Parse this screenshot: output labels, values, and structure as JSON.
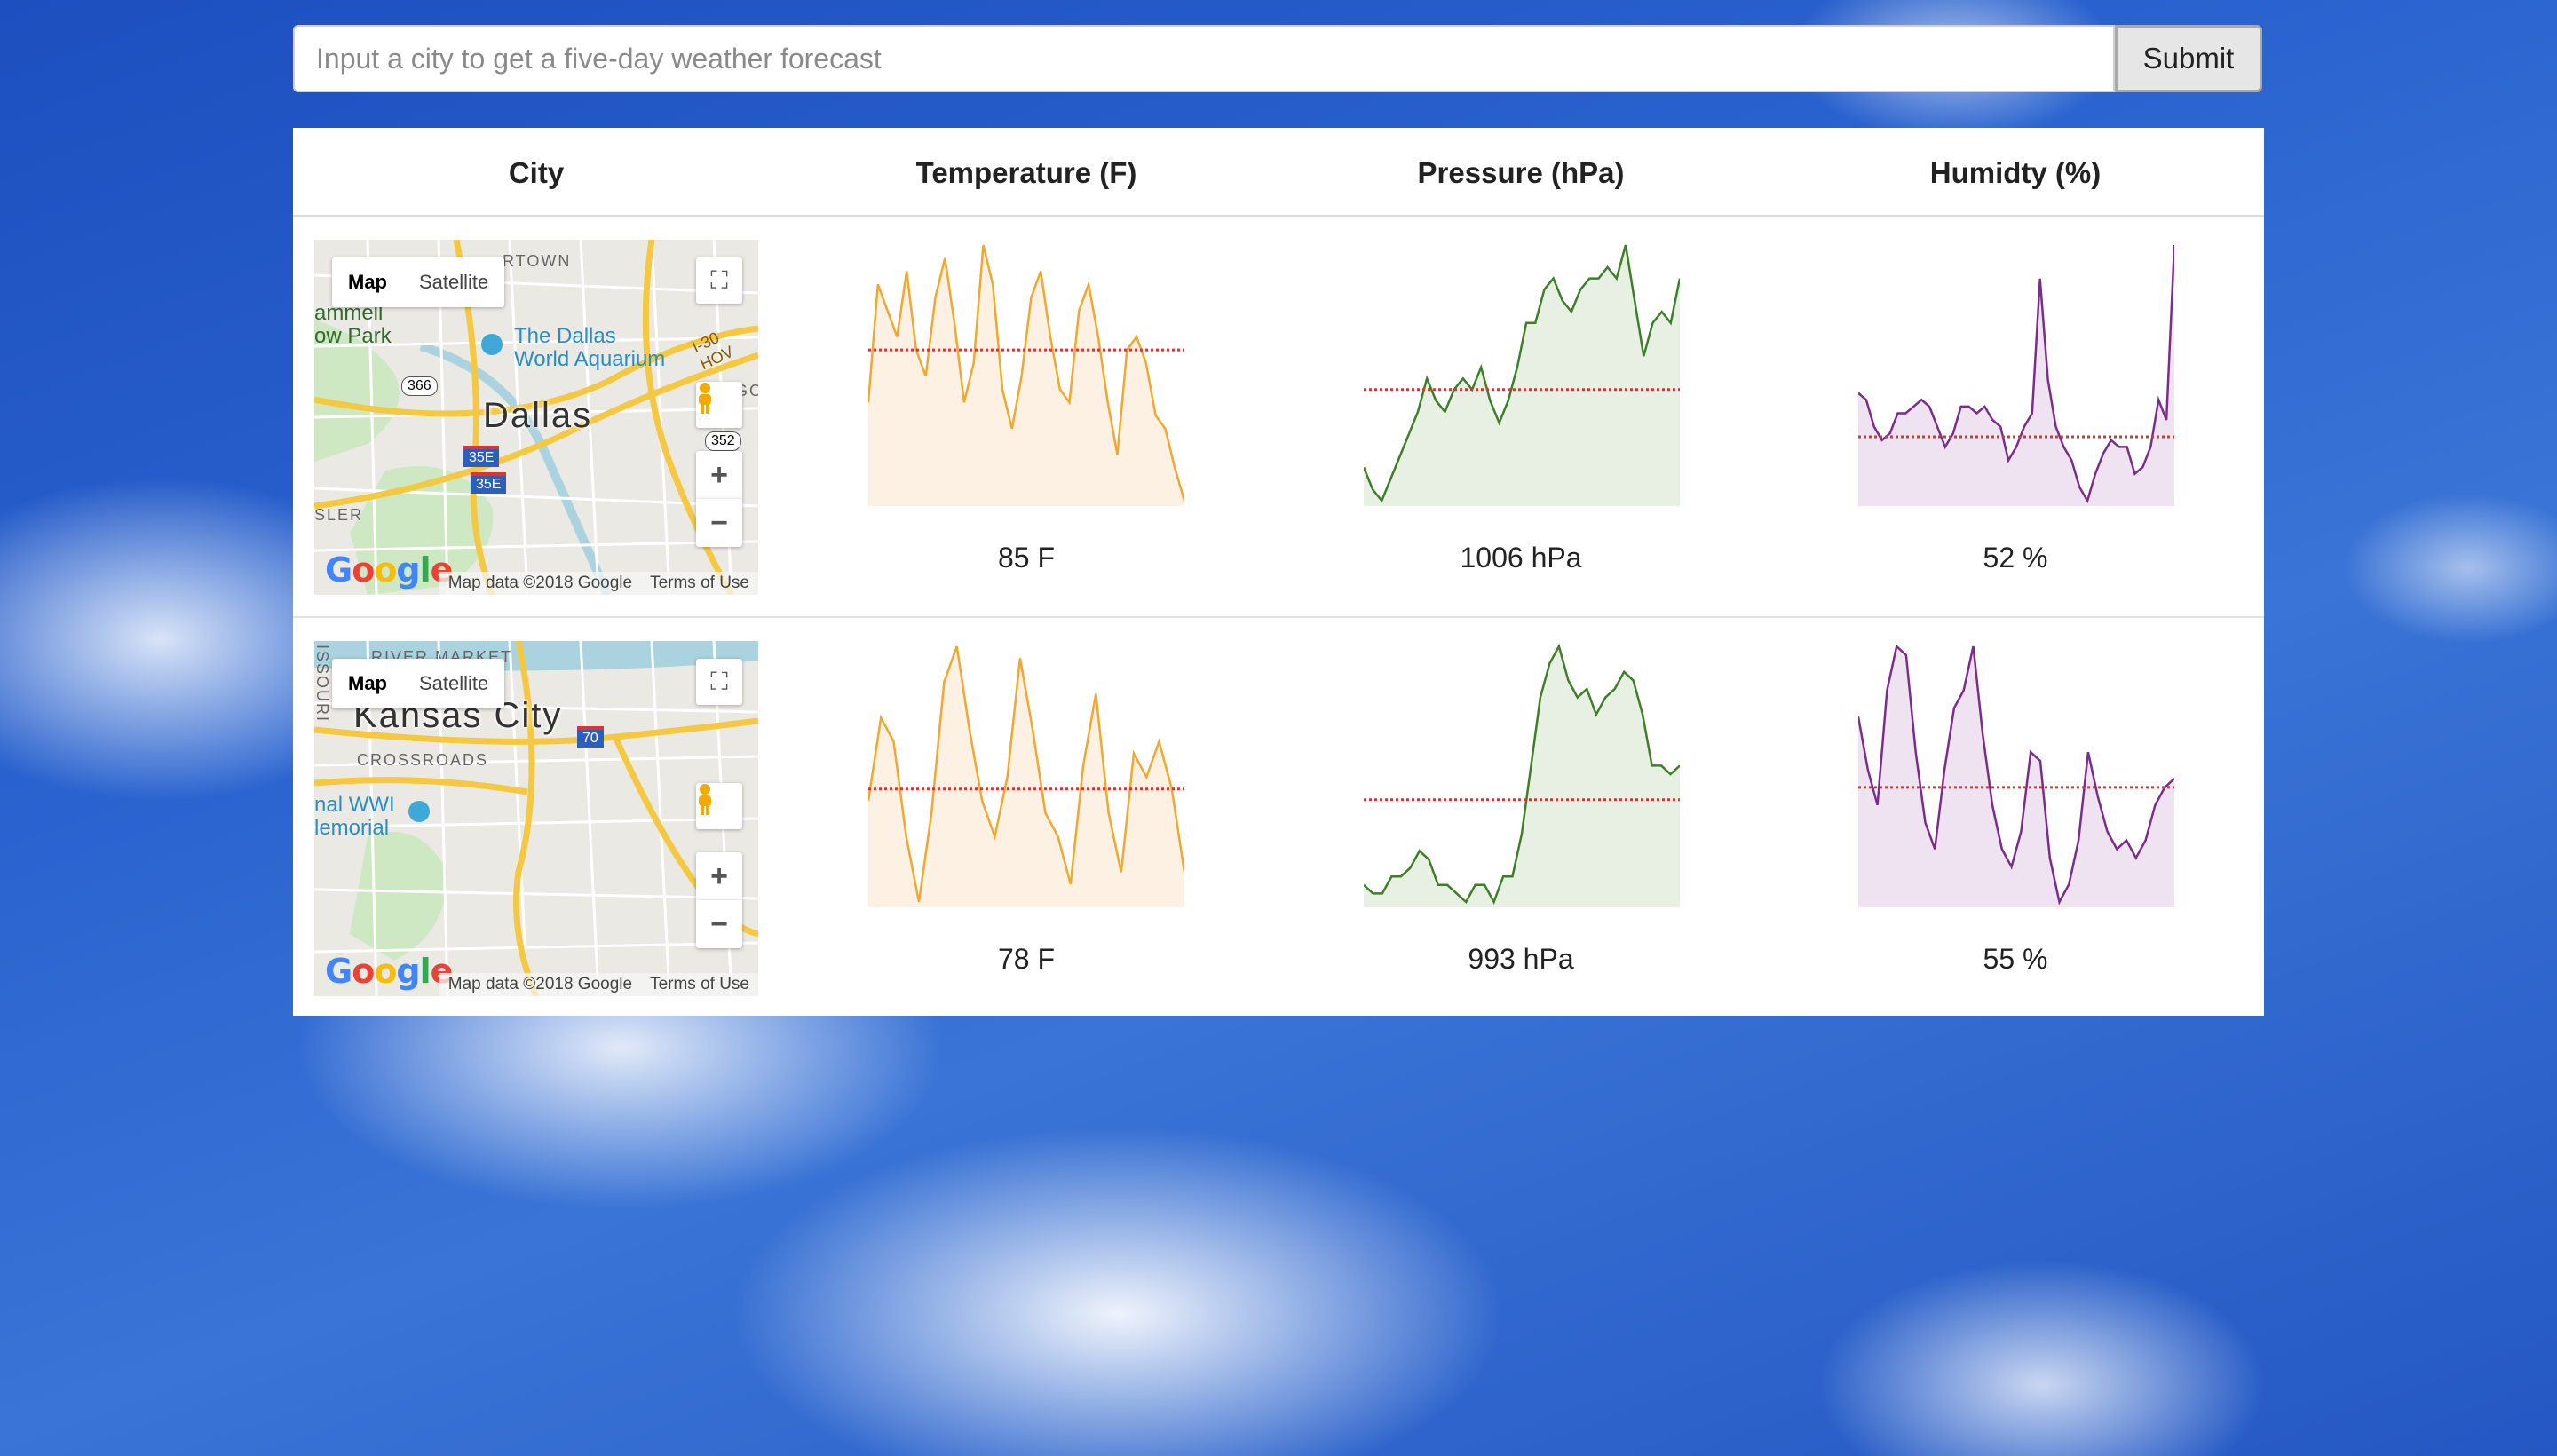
{
  "search": {
    "placeholder": "Input a city to get a five-day weather forecast",
    "value": "",
    "submit_label": "Submit"
  },
  "table": {
    "headers": [
      "City",
      "Temperature (F)",
      "Pressure (hPa)",
      "Humidty (%)"
    ]
  },
  "map_controls": {
    "map_label": "Map",
    "satellite_label": "Satellite",
    "attribution": "Map data ©2018 Google",
    "terms": "Terms of Use",
    "zoom_in": "+",
    "zoom_out": "−",
    "fullscreen": "⛶"
  },
  "rows": [
    {
      "city": "Dallas",
      "map_labels": {
        "city": "Dallas",
        "poi_1": "The Dallas",
        "poi_2": "World Aquarium",
        "park_1": "ammell",
        "park_2": "ow Park",
        "district": "RTOWN",
        "highway": "I-30 HOV",
        "shield_1": "366",
        "shield_2": "35E",
        "shield_3": "35E",
        "shield_4": "352",
        "edge_1": "SLER",
        "edge_2": "GO"
      },
      "temperature": {
        "summary": "85 F",
        "series": [
          70,
          88,
          84,
          80,
          90,
          78,
          74,
          86,
          92,
          82,
          70,
          76,
          94,
          88,
          72,
          66,
          74,
          86,
          90,
          80,
          72,
          70,
          84,
          88,
          80,
          70,
          62,
          78,
          80,
          76,
          68,
          66,
          60,
          55
        ]
      },
      "pressure": {
        "summary": "1006 hPa",
        "series": [
          999,
          997,
          996,
          998,
          1000,
          1002,
          1004,
          1007,
          1005,
          1004,
          1006,
          1007,
          1006,
          1008,
          1005,
          1003,
          1005,
          1008,
          1012,
          1012,
          1015,
          1016,
          1014,
          1013,
          1015,
          1016,
          1016,
          1017,
          1016,
          1019,
          1014,
          1009,
          1012,
          1013,
          1012,
          1016
        ]
      },
      "humidity": {
        "summary": "52 %",
        "series": [
          46,
          44,
          36,
          32,
          34,
          40,
          40,
          42,
          44,
          42,
          36,
          30,
          34,
          42,
          42,
          40,
          42,
          38,
          36,
          26,
          30,
          36,
          40,
          80,
          50,
          36,
          30,
          26,
          18,
          14,
          22,
          28,
          32,
          30,
          30,
          22,
          24,
          30,
          44,
          38,
          90
        ]
      },
      "averages": {
        "temperature": 78,
        "pressure": 1006,
        "humidity": 33
      }
    },
    {
      "city": "Kansas City",
      "map_labels": {
        "city": "Kansas City",
        "poi_1": "nal WWI",
        "poi_2": "lemorial",
        "district": "RIVER MARKET",
        "district_2": "CROSSROADS",
        "shield_1": "70",
        "edge_1": "ISSOURI"
      },
      "temperature": {
        "summary": "78 F",
        "series": [
          72,
          86,
          82,
          66,
          55,
          70,
          92,
          98,
          84,
          72,
          66,
          76,
          96,
          84,
          70,
          66,
          58,
          78,
          90,
          70,
          60,
          80,
          76,
          82,
          74,
          60
        ]
      },
      "pressure": {
        "summary": "993 hPa",
        "series": [
          990,
          989,
          989,
          991,
          991,
          992,
          994,
          993,
          990,
          990,
          989,
          988,
          990,
          990,
          988,
          991,
          991,
          996,
          1004,
          1012,
          1016,
          1018,
          1014,
          1012,
          1013,
          1010,
          1012,
          1013,
          1015,
          1014,
          1010,
          1004,
          1004,
          1003,
          1004
        ]
      },
      "humidity": {
        "summary": "55 %",
        "series": [
          60,
          48,
          40,
          66,
          76,
          74,
          52,
          36,
          30,
          48,
          62,
          66,
          76,
          56,
          40,
          30,
          26,
          34,
          52,
          50,
          28,
          18,
          22,
          32,
          52,
          42,
          34,
          30,
          32,
          28,
          32,
          40,
          44,
          46
        ]
      },
      "averages": {
        "temperature": 74,
        "pressure": 1000,
        "humidity": 44
      }
    }
  ],
  "colors": {
    "temperature": "#f0a830",
    "temperature_fill": "#fdf1e3",
    "pressure": "#3f7f2a",
    "pressure_fill": "#e7f0e3",
    "humidity": "#7a2e8a",
    "humidity_fill": "#efe3f2",
    "average_line": "#e03030"
  }
}
